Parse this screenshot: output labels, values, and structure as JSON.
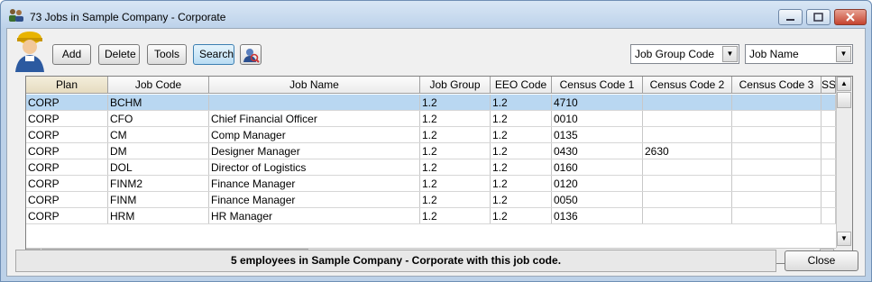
{
  "window": {
    "title": "73 Jobs in Sample Company - Corporate"
  },
  "toolbar": {
    "add_label": "Add",
    "delete_label": "Delete",
    "tools_label": "Tools",
    "search_label": "Search"
  },
  "filters": {
    "group_select": "Job Group Code",
    "name_select": "Job Name"
  },
  "table": {
    "columns": [
      "Plan",
      "Job Code",
      "Job Name",
      "Job Group",
      "EEO Code",
      "Census Code 1",
      "Census Code 2",
      "Census Code 3",
      "SS"
    ],
    "rows": [
      [
        "CORP",
        "BCHM",
        "",
        "1.2",
        "1.2",
        "4710",
        "",
        "",
        ""
      ],
      [
        "CORP",
        "CFO",
        "Chief Financial Officer",
        "1.2",
        "1.2",
        "0010",
        "",
        "",
        ""
      ],
      [
        "CORP",
        "CM",
        "Comp Manager",
        "1.2",
        "1.2",
        "0135",
        "",
        "",
        ""
      ],
      [
        "CORP",
        "DM",
        "Designer Manager",
        "1.2",
        "1.2",
        "0430",
        "2630",
        "",
        ""
      ],
      [
        "CORP",
        "DOL",
        "Director of Logistics",
        "1.2",
        "1.2",
        "0160",
        "",
        "",
        ""
      ],
      [
        "CORP",
        "FINM2",
        "Finance Manager",
        "1.2",
        "1.2",
        "0120",
        "",
        "",
        ""
      ],
      [
        "CORP",
        "FINM",
        "Finance Manager",
        "1.2",
        "1.2",
        "0050",
        "",
        "",
        ""
      ],
      [
        "CORP",
        "HRM",
        "HR Manager",
        "1.2",
        "1.2",
        "0136",
        "",
        "",
        ""
      ]
    ],
    "selected_row": 0
  },
  "status": {
    "text": "5 employees in Sample Company - Corporate with this job code."
  },
  "footer": {
    "close_label": "Close"
  },
  "colors": {
    "selection": "#b9d7f1",
    "titlebar": "#bdd2ea",
    "close_red": "#c5432f"
  }
}
